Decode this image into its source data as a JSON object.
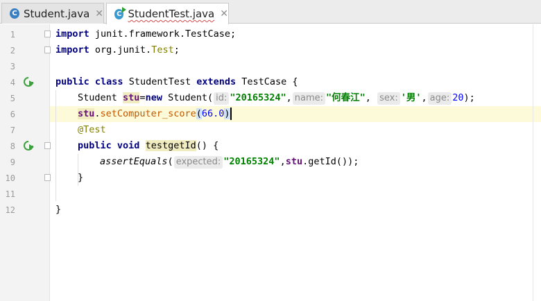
{
  "tabs": [
    {
      "label": "Student.java",
      "icon": "java-class-icon",
      "active": false
    },
    {
      "label": "StudentTest.java",
      "icon": "java-test-class-icon",
      "active": true
    }
  ],
  "line_numbers": [
    "1",
    "2",
    "3",
    "4",
    "5",
    "6",
    "7",
    "8",
    "9",
    "10",
    "11",
    "12"
  ],
  "code": {
    "l1": {
      "kw": "import",
      "rest": " junit.framework.TestCase;"
    },
    "l2": {
      "kw": "import",
      "rest": " org.junit.",
      "test": "Test",
      "end": ";"
    },
    "l4": {
      "kw1": "public",
      "kw2": "class",
      "name": " StudentTest ",
      "kw3": "extends",
      "rest": " TestCase {"
    },
    "l5": {
      "type": "Student ",
      "var": "stu",
      "eq": "=",
      "kw": "new",
      "cls": " Student(",
      "hint_id": "id:",
      "arg_id": "\"20165324\"",
      "comma1": ",",
      "hint_name": "name:",
      "arg_name": "\"何春江\"",
      "comma2": ",",
      "hint_sex": "sex:",
      "arg_sex": "'男'",
      "comma3": ",",
      "hint_age": "age:",
      "arg_age": "20",
      "end": ");"
    },
    "l6": {
      "var": "stu",
      "dot": ".",
      "method": "setComputer_score",
      "open": "(",
      "arg": "66.0",
      "close": ")"
    },
    "l7": {
      "annotation": "@Test"
    },
    "l8": {
      "kw1": "public",
      "kw2": "void",
      "method": "testgetId",
      "rest": "() {"
    },
    "l9": {
      "method": "assertEquals",
      "open": "(",
      "hint": "expected:",
      "arg": "\"20165324\"",
      "comma": ",",
      "var": "stu",
      "rest": ".getId());"
    },
    "l10": {
      "text": "}"
    },
    "l12": {
      "text": "}"
    }
  },
  "gutter_icons": {
    "run": "run-test-icon"
  },
  "colors": {
    "keyword": "#000080",
    "string": "#008000",
    "number": "#0000ff",
    "field": "#660e7a",
    "annotation": "#808000",
    "current_line": "#fcfad8"
  }
}
